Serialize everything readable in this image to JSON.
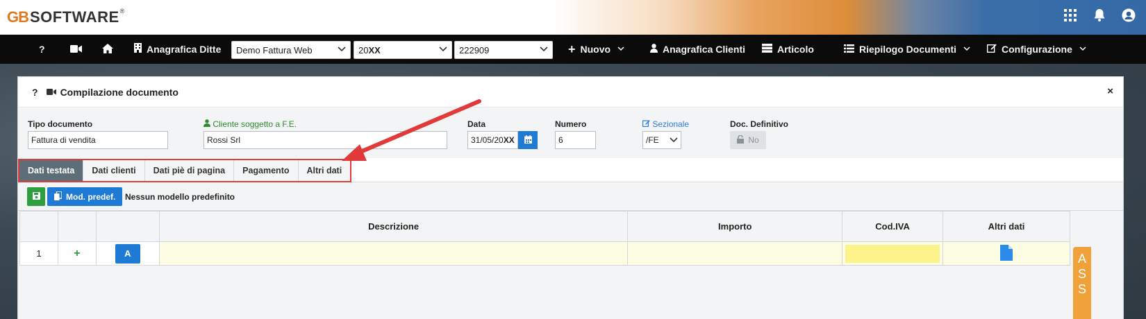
{
  "brand": {
    "logo_gb": "GB",
    "logo_software": "SOFTWARE",
    "logo_reg": "®"
  },
  "top_icons": {
    "apps": "apps-grid-icon",
    "bell": "bell-icon",
    "user": "user-circle-icon"
  },
  "navbar": {
    "help": "?",
    "ditte_label": "Anagrafica Ditte",
    "select_company": "Demo Fattura Web",
    "select_year_prefix": "20",
    "select_year_suffix": "XX",
    "select_code": "222909",
    "nuovo": "Nuovo",
    "clienti": "Anagrafica Clienti",
    "articolo": "Articolo",
    "riepilogo": "Riepilogo Documenti",
    "configurazione": "Configurazione"
  },
  "panel": {
    "help": "?",
    "title": "Compilazione documento",
    "close": "×"
  },
  "form": {
    "tipo_label": "Tipo documento",
    "tipo_value": "Fattura di vendita",
    "cliente_label": "Cliente soggetto a F.E.",
    "cliente_value": "Rossi Srl",
    "data_label": "Data",
    "data_prefix": "31/05/20",
    "data_suffix": "XX",
    "numero_label": "Numero",
    "numero_value": "6",
    "sezionale_label": "Sezionale",
    "sezionale_value": "/FE",
    "definitivo_label": "Doc. Definitivo",
    "definitivo_value": "No"
  },
  "tabs": [
    {
      "label": "Dati testata",
      "active": true
    },
    {
      "label": "Dati clienti",
      "active": false
    },
    {
      "label": "Dati piè di pagina",
      "active": false
    },
    {
      "label": "Pagamento",
      "active": false
    },
    {
      "label": "Altri dati",
      "active": false
    }
  ],
  "toolbar": {
    "mod_label": "Mod. predef.",
    "mod_text": "Nessun modello predefinito"
  },
  "grid": {
    "headers": [
      "",
      "",
      "",
      "Descrizione",
      "Importo",
      "Cod.IVA",
      "Altri dati"
    ],
    "rows": [
      {
        "num": "1",
        "add": "+",
        "a_label": "A",
        "descrizione": "",
        "importo": ""
      }
    ]
  },
  "side_tab": {
    "letters": [
      "A",
      "S",
      "S"
    ]
  },
  "colors": {
    "accent": "#1f7ad6",
    "save": "#2e9e3e",
    "annotation": "#e03a3a",
    "active_tab": "#5d6e79"
  }
}
